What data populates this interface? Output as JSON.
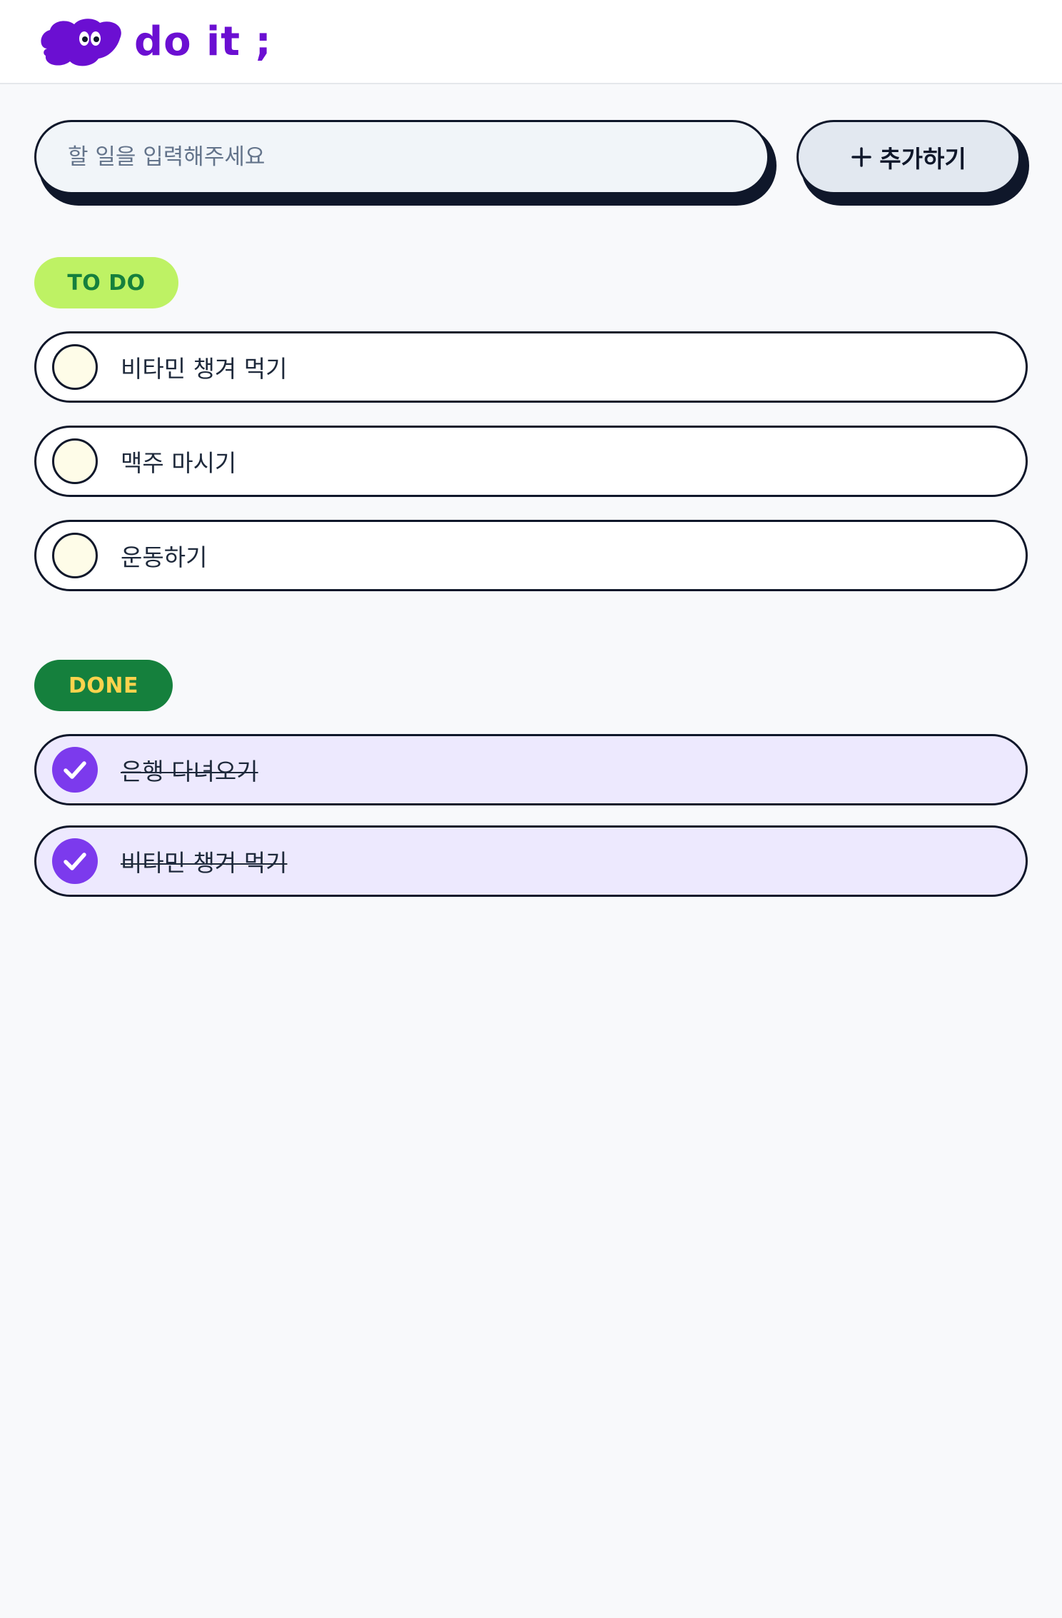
{
  "header": {
    "logo_text": "do it ;",
    "colors": {
      "brand": "#6B0FD2"
    }
  },
  "search": {
    "placeholder": "할 일을 입력해주세요",
    "value": ""
  },
  "add_button": {
    "icon": "plus-icon",
    "label": "추가하기"
  },
  "todo": {
    "badge": "TO DO",
    "items": [
      {
        "label": "비타민 챙겨 먹기",
        "done": false
      },
      {
        "label": "맥주 마시기",
        "done": false
      },
      {
        "label": "운동하기",
        "done": false
      }
    ]
  },
  "done": {
    "badge": "DONE",
    "items": [
      {
        "label": "은행 다녀오기",
        "done": true
      },
      {
        "label": "비타민 챙겨 먹기",
        "done": true
      }
    ]
  },
  "colors": {
    "todo_badge_bg": "#BEF264",
    "todo_badge_text": "#15803D",
    "done_badge_bg": "#15803D",
    "done_badge_text": "#FCD34D",
    "done_item_bg": "#EDE9FE",
    "check_done": "#7C3AED"
  }
}
